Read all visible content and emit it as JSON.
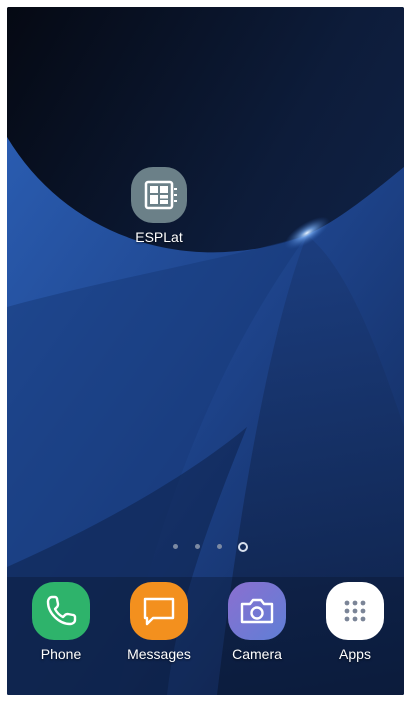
{
  "home_screen": {
    "apps": [
      {
        "label": "ESPLat",
        "icon": "esplat-app-icon"
      }
    ]
  },
  "page_indicator": {
    "count": 4,
    "active_index": 3
  },
  "dock": {
    "apps": [
      {
        "label": "Phone",
        "icon": "phone-icon",
        "color": "#2eb36b"
      },
      {
        "label": "Messages",
        "icon": "messages-icon",
        "color": "#f3901e"
      },
      {
        "label": "Camera",
        "icon": "camera-icon",
        "color": "#7a74c8"
      },
      {
        "label": "Apps",
        "icon": "apps-grid-icon",
        "color": "#ffffff"
      }
    ]
  }
}
